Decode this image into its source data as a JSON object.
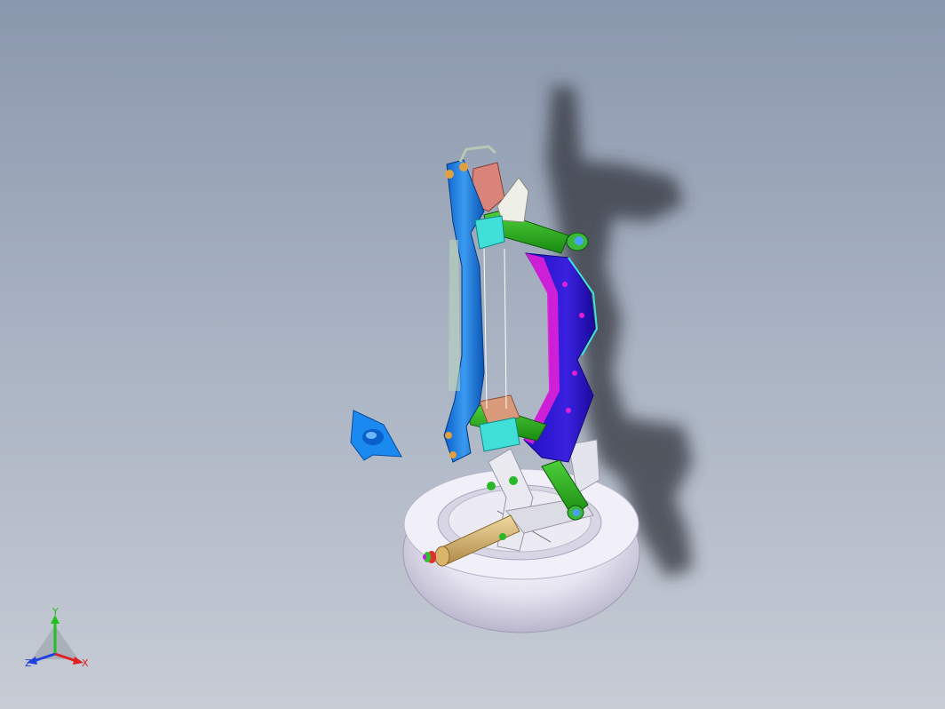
{
  "viewport": {
    "background_top": "#8a98ad",
    "background_bottom": "#c7ccd5"
  },
  "model": {
    "parts": [
      "subframe-rail-blue",
      "subframe-crossmember-purple",
      "upper-link-green",
      "lower-link-green",
      "bracket-cyan",
      "knuckle-grey",
      "shock-absorber-tan",
      "tire-white",
      "loose-bracket-blue"
    ]
  },
  "triad": {
    "x_label": "X",
    "y_label": "Y",
    "z_label": "Z",
    "x_color": "#e02020",
    "y_color": "#20c020",
    "z_color": "#2040e0"
  }
}
